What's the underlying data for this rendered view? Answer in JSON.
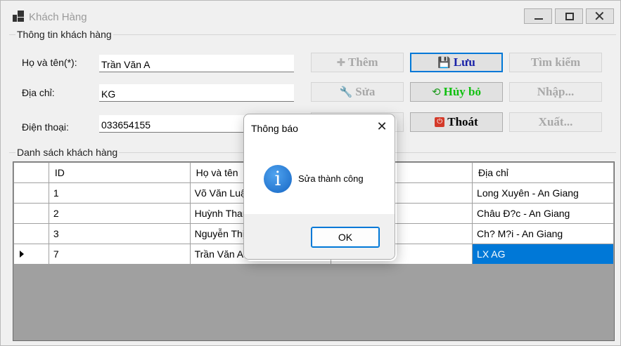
{
  "window": {
    "title": "Khách Hàng"
  },
  "info_group": {
    "legend": "Thông tin khách hàng",
    "fields": {
      "name_label": "Họ và tên(*):",
      "name_value": "Trần Văn A",
      "address_label": "Địa chỉ:",
      "address_value": "KG",
      "phone_label": "Điện thoại:",
      "phone_value": "033654155"
    }
  },
  "buttons": {
    "add": {
      "label": "Thêm",
      "icon": "plus-icon",
      "enabled": false
    },
    "save": {
      "label": "Lưu",
      "icon": "floppy-disk-icon",
      "enabled": true,
      "color": "#1a22a8"
    },
    "search": {
      "label": "Tìm kiếm",
      "enabled": false
    },
    "edit": {
      "label": "Sửa",
      "icon": "wrench-icon",
      "enabled": false
    },
    "cancel": {
      "label": "Hủy bỏ",
      "icon": "refresh-icon",
      "enabled": true,
      "color": "#10c010"
    },
    "import": {
      "label": "Nhập...",
      "enabled": false
    },
    "delete": {
      "label": "",
      "enabled": false
    },
    "exit": {
      "label": "Thoát",
      "icon": "power-icon",
      "enabled": true,
      "color": "#000000"
    },
    "export": {
      "label": "Xuất...",
      "enabled": false
    }
  },
  "list_group": {
    "legend": "Danh sách khách hàng",
    "columns": [
      "ID",
      "Họ và tên",
      "",
      "Địa chỉ"
    ],
    "rows": [
      {
        "id": "1",
        "name": "Võ Văn Luậ",
        "phone": "",
        "address": "Long Xuyên - An Giang",
        "current": false
      },
      {
        "id": "2",
        "name": "Huỳnh Thar",
        "phone": "",
        "address": "Châu Đ?c - An Giang",
        "current": false
      },
      {
        "id": "3",
        "name": "Nguyễn Thị",
        "phone": "",
        "address": "Ch? M?i - An Giang",
        "current": false
      },
      {
        "id": "7",
        "name": "Trần Văn A",
        "phone": "",
        "address": "LX AG",
        "current": true
      }
    ]
  },
  "dialog": {
    "title": "Thông báo",
    "message": "Sửa thành công",
    "ok_label": "OK",
    "icon": "information-icon"
  },
  "colors": {
    "selection": "#0078d7",
    "accent_focus": "#0078d7"
  }
}
